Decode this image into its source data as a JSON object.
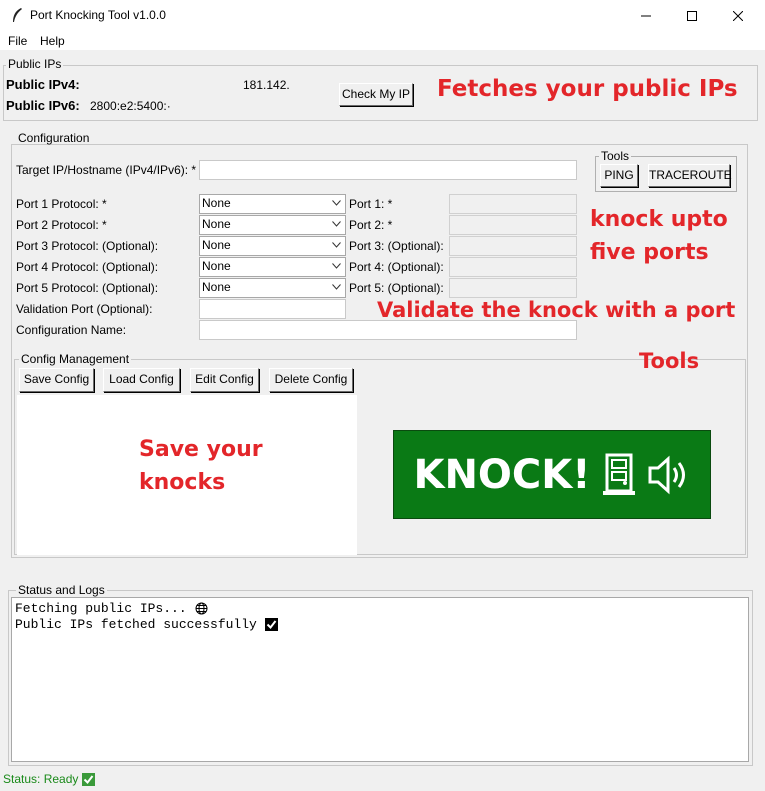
{
  "window": {
    "title": "Port Knocking Tool v1.0.0"
  },
  "menu": {
    "file": "File",
    "help": "Help"
  },
  "public_ips": {
    "group_label": "Public IPs",
    "ipv4_label": "Public IPv4:",
    "ipv4_value": "181.142.",
    "ipv6_label": "Public IPv6:",
    "ipv6_value": "2800:e2:5400:·",
    "check_button": "Check My IP"
  },
  "configuration": {
    "group_label": "Configuration",
    "target_label": "Target IP/Hostname (IPv4/IPv6): *",
    "target_value": "",
    "ports": [
      {
        "protocol_label": "Port 1 Protocol: *",
        "protocol_value": "None",
        "port_label": "Port 1: *"
      },
      {
        "protocol_label": "Port 2 Protocol: *",
        "protocol_value": "None",
        "port_label": "Port 2: *"
      },
      {
        "protocol_label": "Port 3 Protocol: (Optional):",
        "protocol_value": "None",
        "port_label": "Port 3: (Optional):"
      },
      {
        "protocol_label": "Port 4 Protocol: (Optional):",
        "protocol_value": "None",
        "port_label": "Port 4: (Optional):"
      },
      {
        "protocol_label": "Port 5 Protocol: (Optional):",
        "protocol_value": "None",
        "port_label": "Port 5: (Optional):"
      }
    ],
    "validation_label": "Validation Port (Optional):",
    "config_name_label": "Configuration Name:"
  },
  "tools": {
    "group_label": "Tools",
    "ping": "PING",
    "traceroute": "TRACEROUTE"
  },
  "config_management": {
    "group_label": "Config Management",
    "save": "Save Config",
    "load": "Load Config",
    "edit": "Edit Config",
    "delete": "Delete Config"
  },
  "knock_button": {
    "label": "KNOCK!",
    "color": "#0a7a15"
  },
  "status_logs": {
    "group_label": "Status and Logs",
    "lines": [
      {
        "text": "Fetching public IPs...",
        "icon": "globe-icon"
      },
      {
        "text": "Public IPs fetched successfully",
        "icon": "check-icon"
      }
    ]
  },
  "status_bar": {
    "text": "Status: Ready"
  },
  "annotations": {
    "color": "#e3262a",
    "fetch_ips": "Fetches your public IPs",
    "knock_upto": "knock upto",
    "five_ports": "five ports",
    "validate": "Validate the knock with a port",
    "tools": "Tools",
    "save_your": "Save your",
    "knocks": "knocks"
  }
}
